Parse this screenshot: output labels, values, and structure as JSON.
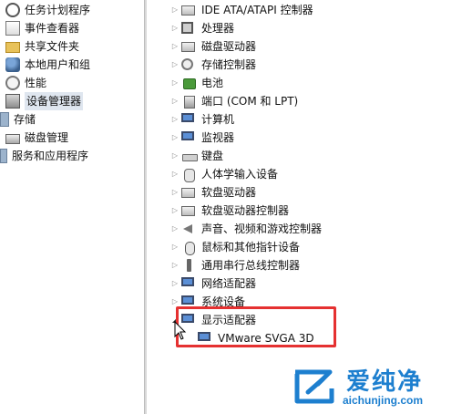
{
  "left_tree": {
    "items": [
      {
        "label": "任务计划程序",
        "icon": "clock-icon"
      },
      {
        "label": "事件查看器",
        "icon": "event-viewer-icon"
      },
      {
        "label": "共享文件夹",
        "icon": "shared-folder-icon"
      },
      {
        "label": "本地用户和组",
        "icon": "users-icon"
      },
      {
        "label": "性能",
        "icon": "performance-icon"
      },
      {
        "label": "设备管理器",
        "icon": "device-manager-icon",
        "selected": true
      },
      {
        "label": "存储",
        "icon": "storage-icon"
      },
      {
        "label": "磁盘管理",
        "icon": "disk-icon"
      },
      {
        "label": "服务和应用程序",
        "icon": "services-icon"
      }
    ]
  },
  "device_tree": {
    "items": [
      {
        "label": "IDE ATA/ATAPI 控制器",
        "icon": "ide-controller-icon",
        "expanded": false
      },
      {
        "label": "处理器",
        "icon": "processor-icon",
        "expanded": false
      },
      {
        "label": "磁盘驱动器",
        "icon": "disk-drive-icon",
        "expanded": false
      },
      {
        "label": "存储控制器",
        "icon": "storage-controller-icon",
        "expanded": false
      },
      {
        "label": "电池",
        "icon": "battery-icon",
        "expanded": false
      },
      {
        "label": "端口 (COM 和 LPT)",
        "icon": "port-icon",
        "expanded": false
      },
      {
        "label": "计算机",
        "icon": "computer-icon",
        "expanded": false
      },
      {
        "label": "监视器",
        "icon": "monitor-icon",
        "expanded": false
      },
      {
        "label": "键盘",
        "icon": "keyboard-icon",
        "expanded": false
      },
      {
        "label": "人体学输入设备",
        "icon": "hid-icon",
        "expanded": false
      },
      {
        "label": "软盘驱动器",
        "icon": "floppy-drive-icon",
        "expanded": false
      },
      {
        "label": "软盘驱动器控制器",
        "icon": "floppy-controller-icon",
        "expanded": false
      },
      {
        "label": "声音、视频和游戏控制器",
        "icon": "sound-icon",
        "expanded": false
      },
      {
        "label": "鼠标和其他指针设备",
        "icon": "mouse-icon",
        "expanded": false
      },
      {
        "label": "通用串行总线控制器",
        "icon": "usb-icon",
        "expanded": false
      },
      {
        "label": "网络适配器",
        "icon": "network-adapter-icon",
        "expanded": false
      },
      {
        "label": "系统设备",
        "icon": "system-devices-icon",
        "expanded": false
      },
      {
        "label": "显示适配器",
        "icon": "display-adapter-icon",
        "expanded": true
      }
    ],
    "child": {
      "label": "VMware SVGA 3D",
      "icon": "display-adapter-icon"
    }
  },
  "watermark": {
    "title": "爱纯净",
    "url": "aichunjing.com"
  },
  "colors": {
    "highlight_border": "#e53131",
    "selection_bg": "#dfe6ef",
    "watermark_blue": "#1d7fcf"
  }
}
